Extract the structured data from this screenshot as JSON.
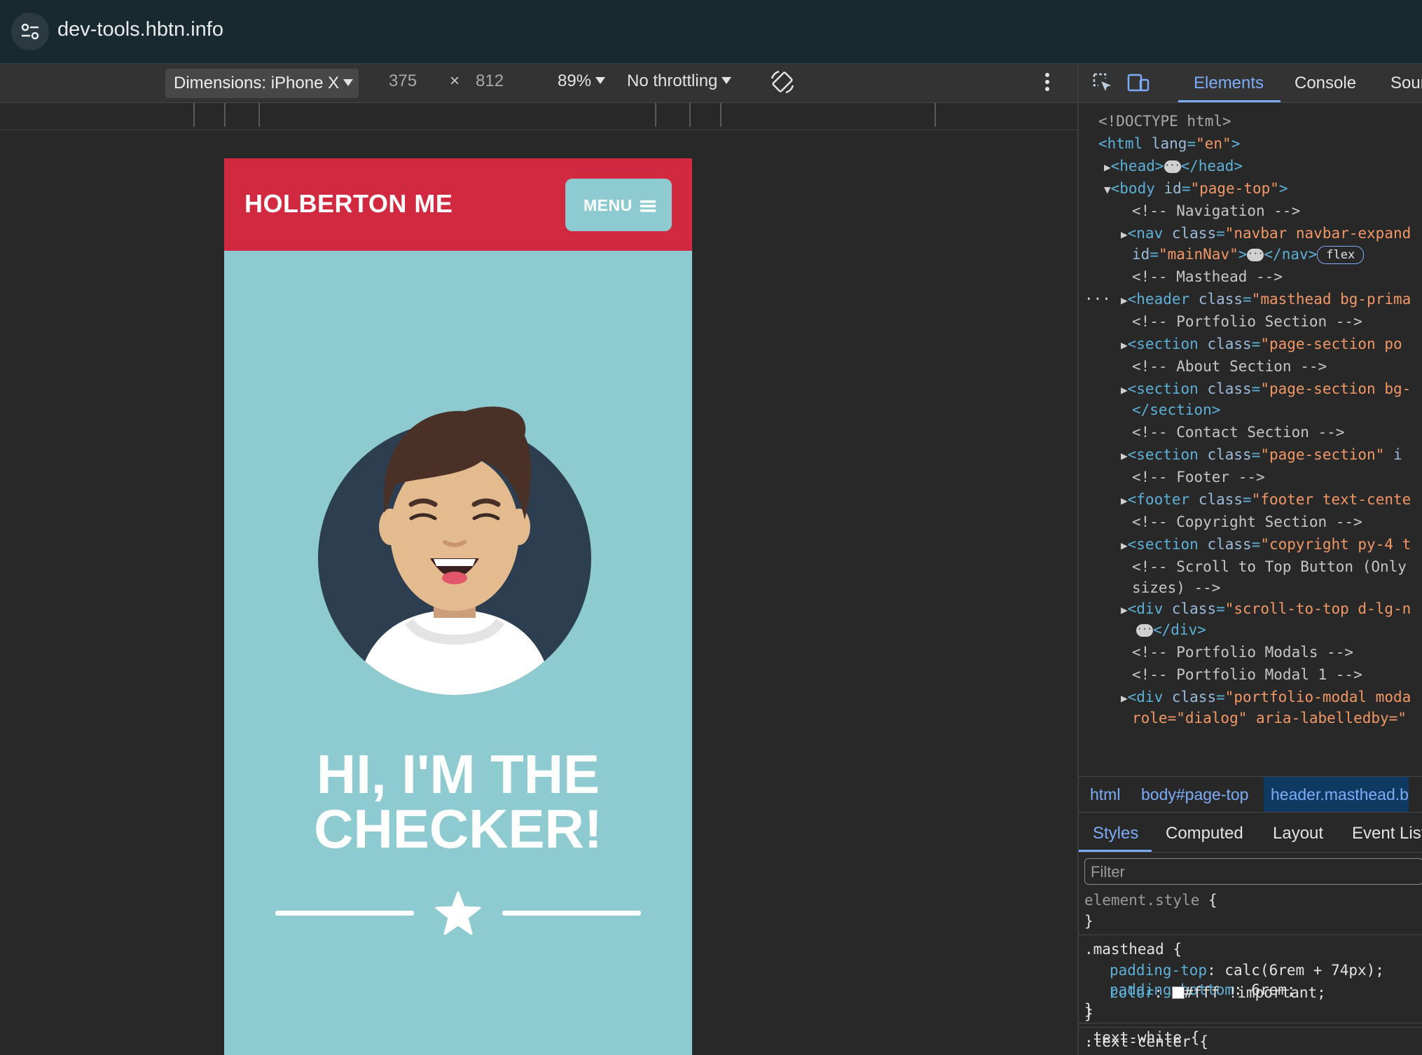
{
  "browser": {
    "url": "dev-tools.hbtn.info"
  },
  "device_toolbar": {
    "dimensions_label": "Dimensions: iPhone X",
    "width": "375",
    "times": "×",
    "height": "812",
    "zoom": "89%",
    "throttling": "No throttling"
  },
  "site": {
    "brand": "HOLBERTON ME",
    "menu_label": "MENU",
    "hero_title_line1": "HI, I'M THE",
    "hero_title_line2": "CHECKER!",
    "colors": {
      "nav": "#d1293f",
      "primary": "#8ecbd1",
      "avatar_bg": "#2d3e50"
    }
  },
  "devtools": {
    "tabs": [
      "Elements",
      "Console",
      "Sour"
    ],
    "active_tab": "Elements",
    "dom": {
      "doctype": "<!DOCTYPE html>",
      "html_open": "<html",
      "lang_attr": "lang",
      "lang_val": "\"en\"",
      "head_open": "<head>",
      "head_close": "</head>",
      "body_open": "<body",
      "id_attr": "id",
      "body_id": "\"page-top\"",
      "c_navigation": "<!-- Navigation -->",
      "nav_open": "<nav",
      "class_attr": "class",
      "nav_class": "\"navbar navbar-expand",
      "nav_id": "\"mainNav\"",
      "nav_close": "</nav>",
      "flex_badge": "flex",
      "c_masthead": "<!-- Masthead -->",
      "header_open": "<header",
      "header_class": "\"masthead bg-prima",
      "c_portfolio": "<!-- Portfolio Section -->",
      "section_open": "<section",
      "sec1_class": "\"page-section po",
      "c_about": "<!-- About Section -->",
      "sec2_class": "\"page-section bg-",
      "section_close": "</section>",
      "c_contact": "<!-- Contact Section -->",
      "sec3_class": "\"page-section\"",
      "sec3_tail": "i",
      "c_footer": "<!-- Footer -->",
      "footer_open": "<footer",
      "footer_class": "\"footer text-cente",
      "c_copyright": "<!-- Copyright Section -->",
      "sec4_class": "\"copyright py-4 t",
      "c_scroll1": "<!-- Scroll to Top Button (Only",
      "c_scroll2": "sizes) -->",
      "div_open": "<div",
      "div1_class": "\"scroll-to-top d-lg-n",
      "div_close": "</div>",
      "c_modals": "<!-- Portfolio Modals -->",
      "c_modal1": "<!-- Portfolio Modal 1 -->",
      "div2_class": "\"portfolio-modal moda",
      "role_line": "role=\"dialog\" aria-labelledby=\""
    },
    "breadcrumb": [
      "html",
      "body#page-top",
      "header.masthead.b"
    ],
    "styles_tabs": [
      "Styles",
      "Computed",
      "Layout",
      "Event List"
    ],
    "filter_placeholder": "Filter",
    "styles": {
      "element_style": "element.style",
      "open_brace": "{",
      "close_brace": "}",
      "masthead_sel": ".masthead",
      "pt_prop": "padding-top",
      "pt_val": "calc(6rem + 74px);",
      "pb_prop": "padding-bottom",
      "pb_val": "6rem;",
      "text_white_sel": ".text-white",
      "color_prop": "color",
      "color_val": "#fff !important;",
      "text_center_sel": ".text-center"
    }
  }
}
